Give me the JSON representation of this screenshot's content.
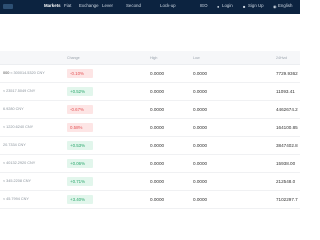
{
  "nav": {
    "items": [
      "Markets",
      "Fiat",
      "Exchange",
      "Lever",
      "Second",
      "Lock-up",
      "IEO"
    ],
    "login": "Login",
    "signup": "Sign Up",
    "language": "English"
  },
  "table": {
    "headers": {
      "change": "Change",
      "high": "High",
      "low": "Low",
      "volume": "24Hvol"
    },
    "rows": [
      {
        "pair": "000",
        "pair_sub": "≈ 300014.5320 CNY",
        "change": "-0.10%",
        "dir": "down",
        "high": "0.0000",
        "low": "0.0000",
        "volume": "7729.9362"
      },
      {
        "pair": "",
        "pair_sub": "≈ 23517.5049 CNY",
        "change": "+0.52%",
        "dir": "up",
        "high": "0.0000",
        "low": "0.0000",
        "volume": "11093.41"
      },
      {
        "pair": "",
        "pair_sub": "6.9280 CNY",
        "change": "-0.67%",
        "dir": "down",
        "high": "0.0000",
        "low": "0.0000",
        "volume": "4462674.2"
      },
      {
        "pair": "",
        "pair_sub": "≈ 1220.6240 CNY",
        "change": "0.58%",
        "dir": "down",
        "high": "0.0000",
        "low": "0.0000",
        "volume": "164100.85"
      },
      {
        "pair": "",
        "pair_sub": "20.7334 CNY",
        "change": "+0.53%",
        "dir": "up",
        "high": "0.0000",
        "low": "0.0000",
        "volume": "3847402.8"
      },
      {
        "pair": "",
        "pair_sub": "≈ 40132.2920 CNY",
        "change": "+0.06%",
        "dir": "up",
        "high": "0.0000",
        "low": "0.0000",
        "volume": "15938.00"
      },
      {
        "pair": "",
        "pair_sub": "≈ 345.2208 CNY",
        "change": "+0.71%",
        "dir": "up",
        "high": "0.0000",
        "low": "0.0000",
        "volume": "212548.0"
      },
      {
        "pair": "",
        "pair_sub": "≈ 45.7994 CNY",
        "change": "+3.40%",
        "dir": "up",
        "high": "0.0000",
        "low": "0.0000",
        "volume": "7102297.7"
      }
    ]
  }
}
